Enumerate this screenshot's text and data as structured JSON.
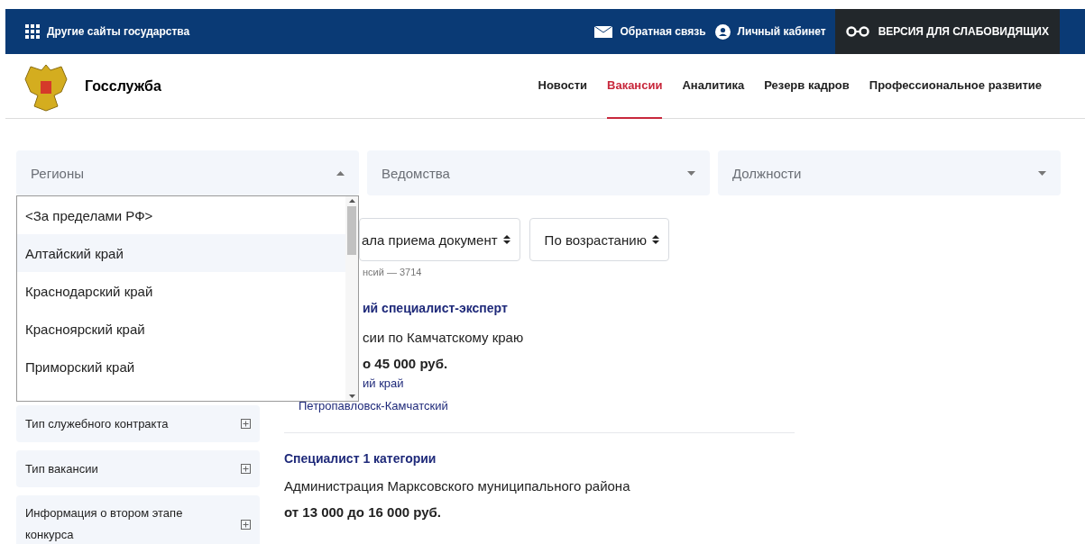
{
  "topbar": {
    "other_sites": "Другие сайты государства",
    "feedback": "Обратная связь",
    "cabinet": "Личный кабинет",
    "accessibility": "ВЕРСИЯ ДЛЯ СЛАБОВИДЯЩИХ"
  },
  "header": {
    "logo_text": "Госслужба",
    "nav": [
      {
        "label": "Новости",
        "selected": false
      },
      {
        "label": "Вакансии",
        "selected": true
      },
      {
        "label": "Аналитика",
        "selected": false
      },
      {
        "label": "Резерв кадров",
        "selected": false
      },
      {
        "label": "Профессиональное развитие",
        "selected": false
      }
    ]
  },
  "filters": [
    {
      "placeholder": "Регионы",
      "expanded": true
    },
    {
      "placeholder": "Ведомства",
      "expanded": false
    },
    {
      "placeholder": "Должности",
      "expanded": false
    }
  ],
  "region_options": [
    {
      "label": "<За пределами РФ>",
      "selected": false
    },
    {
      "label": "Алтайский край",
      "selected": true
    },
    {
      "label": "Краснодарский край",
      "selected": false
    },
    {
      "label": "Красноярский край",
      "selected": false
    },
    {
      "label": "Приморский край",
      "selected": false
    }
  ],
  "sort": [
    {
      "value": "ала приема документ"
    },
    {
      "value": "По возрастанию"
    }
  ],
  "count": "нсий — 3714",
  "sidebar": [
    {
      "label": "Тип служебного контракта",
      "expanded": false
    },
    {
      "label": "Тип вакансии",
      "expanded": false
    },
    {
      "label": "Информация о втором этапе конкурса",
      "expanded": false
    }
  ],
  "jobs": [
    {
      "title": "ий специалист-эксперт",
      "org": "сии по Камчатскому краю",
      "salary": "о 45 000 руб.",
      "region": "ий край",
      "city": "Петропавловск-Камчатский"
    },
    {
      "title": "Специалист 1 категории",
      "org": "Администрация Марксовского муниципального района",
      "salary": "от 13 000 до 16 000 руб."
    }
  ]
}
